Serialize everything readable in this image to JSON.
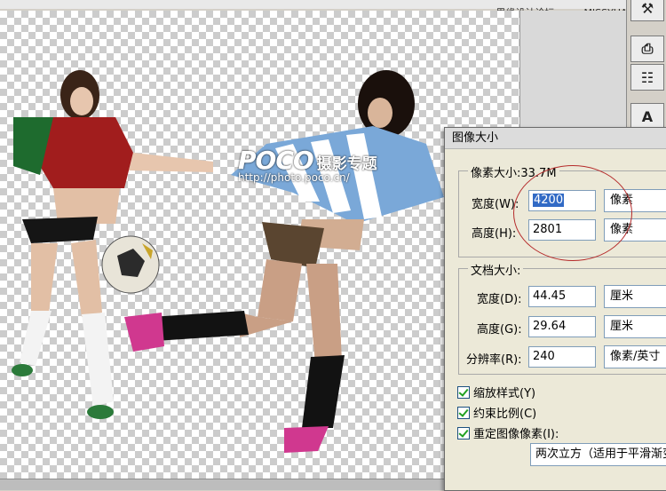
{
  "site_watermark": "思缘设计论坛 www.MISSYUAN.COM",
  "photo_watermark": {
    "logo": "POCO",
    "title": "摄影专题",
    "url": "http://photo.poco.cn/"
  },
  "toolbar": {
    "tools": [
      {
        "icon": "wand-icon",
        "glyph": "⚒"
      },
      {
        "icon": "usb-icon",
        "glyph": "⎙"
      },
      {
        "icon": "clone-stamp-icon",
        "glyph": "☷"
      },
      {
        "icon": "text-tool-icon",
        "glyph": "A"
      }
    ]
  },
  "dialog": {
    "title": "图像大小",
    "pixel_dimensions": {
      "legend": "像素大小:33.7M",
      "width_label": "宽度(W):",
      "width_value": "4200",
      "width_unit": "像素",
      "height_label": "高度(H):",
      "height_value": "2801",
      "height_unit": "像素"
    },
    "document_size": {
      "legend": "文档大小:",
      "width_label": "宽度(D):",
      "width_value": "44.45",
      "width_unit": "厘米",
      "height_label": "高度(G):",
      "height_value": "29.64",
      "height_unit": "厘米",
      "resolution_label": "分辨率(R):",
      "resolution_value": "240",
      "resolution_unit": "像素/英寸"
    },
    "checkboxes": [
      {
        "label": "缩放样式(Y)",
        "checked": true
      },
      {
        "label": "约束比例(C)",
        "checked": true
      },
      {
        "label": "重定图像像素(I):",
        "checked": true
      }
    ],
    "resample_method": "两次立方（适用于平滑渐变）"
  },
  "colors": {
    "highlight": "#316ac5",
    "annotation_circle": "#b52a2a"
  }
}
